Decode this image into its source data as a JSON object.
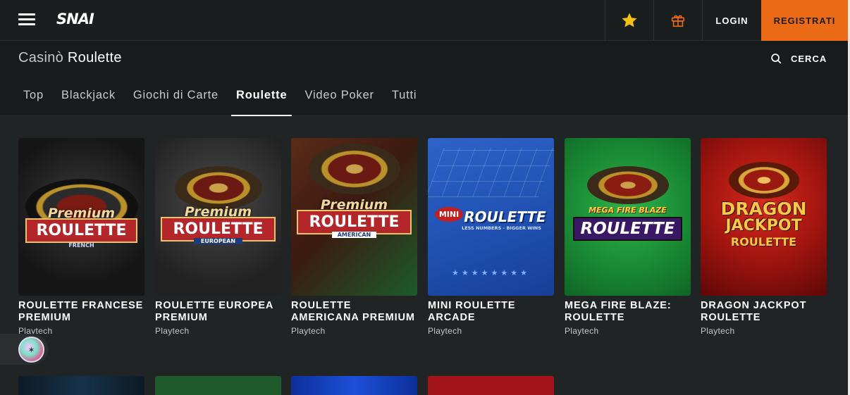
{
  "header": {
    "logo": "SNAI",
    "login_label": "LOGIN",
    "register_label": "REGISTRATI",
    "colors": {
      "accent": "#ea6a16",
      "star": "#f3c10f",
      "gift": "#ea6a16"
    }
  },
  "title": {
    "section": "Casinò",
    "category": "Roulette"
  },
  "search": {
    "label": "CERCA"
  },
  "tabs": [
    {
      "label": "Top"
    },
    {
      "label": "Blackjack"
    },
    {
      "label": "Giochi di Carte"
    },
    {
      "label": "Roulette"
    },
    {
      "label": "Video Poker"
    },
    {
      "label": "Tutti"
    }
  ],
  "games": [
    {
      "name": "Roulette Francese Premium",
      "provider": "Playtech",
      "art_top": "Premium",
      "art_main": "ROULETTE",
      "art_sub": "FRENCH"
    },
    {
      "name": "Roulette Europea Premium",
      "provider": "Playtech",
      "art_top": "Premium",
      "art_main": "ROULETTE",
      "art_sub": "EUROPEAN"
    },
    {
      "name": "Roulette Americana Premium",
      "provider": "Playtech",
      "art_top": "Premium",
      "art_main": "ROULETTE",
      "art_sub": "AMERICAN"
    },
    {
      "name": "Mini Roulette Arcade",
      "provider": "Playtech",
      "art_top": "MINI",
      "art_main": "ROULETTE",
      "art_sub": "LESS NUMBERS - BIGGER WINS"
    },
    {
      "name": "Mega Fire Blaze: Roulette",
      "provider": "Playtech",
      "art_top": "MEGA FIRE BLAZE",
      "art_main": "ROULETTE",
      "art_sub": ""
    },
    {
      "name": "Dragon Jackpot Roulette",
      "provider": "Playtech",
      "art_top": "DRAGON",
      "art_main": "JACKPOT",
      "art_sub": "ROULETTE"
    }
  ]
}
